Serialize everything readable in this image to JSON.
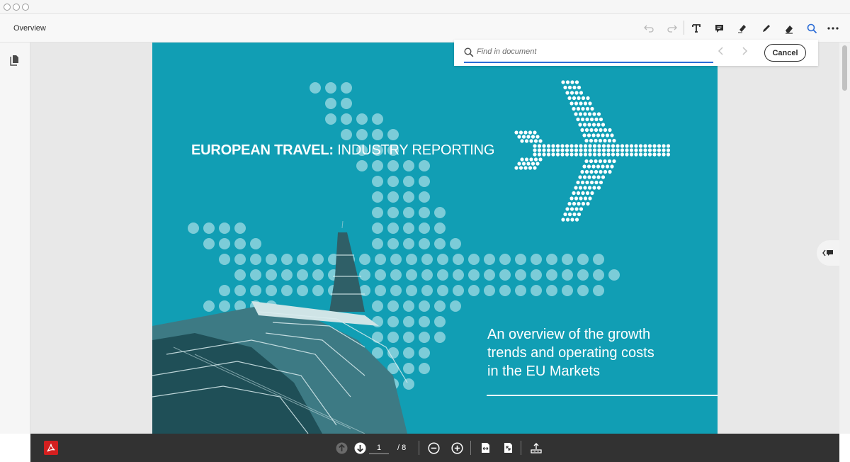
{
  "window": {
    "title": "Overview"
  },
  "find": {
    "placeholder": "Find in document",
    "value": "",
    "cancel_label": "Cancel"
  },
  "document": {
    "headline_bold": "EUROPEAN TRAVEL:",
    "headline_rest": " INDUSTRY REPORTING",
    "subtitle_lines": [
      "An overview of the growth",
      "trends and operating costs",
      "in the EU Markets"
    ],
    "background_color": "#119eb4"
  },
  "pager": {
    "current": "1",
    "total": "/ 8"
  },
  "icons": {
    "toolbar": [
      "undo-icon",
      "redo-icon",
      "text-tool-icon",
      "comment-icon",
      "highlight-icon",
      "pencil-icon",
      "eraser-icon",
      "search-icon",
      "more-icon"
    ],
    "bottom": [
      "acrobat-logo-icon",
      "previous-page-icon",
      "next-page-icon",
      "zoom-out-icon",
      "zoom-in-icon",
      "fit-width-icon",
      "fit-page-icon",
      "export-icon"
    ]
  },
  "colors": {
    "accent": "#2b6cd6",
    "acrobat_red": "#d41f1f",
    "bottom_bar": "#323232"
  }
}
